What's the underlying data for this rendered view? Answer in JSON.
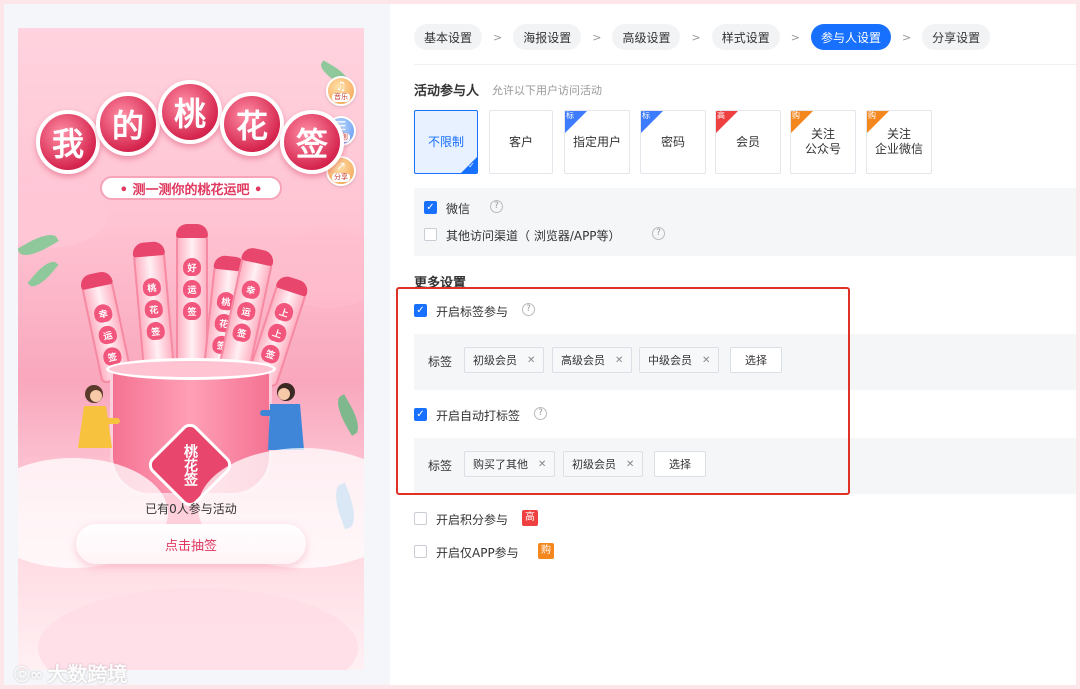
{
  "preview": {
    "title_chars": [
      "我",
      "的",
      "桃",
      "花",
      "签"
    ],
    "subtitle": "• 测一测你的桃花运吧 •",
    "side_buttons": [
      {
        "label": "音乐",
        "icon": "music-icon"
      },
      {
        "label": "规则",
        "icon": "rules-icon"
      },
      {
        "label": "分享",
        "icon": "share-icon"
      }
    ],
    "sticks": [
      {
        "chars": [
          "幸",
          "运",
          "签"
        ]
      },
      {
        "chars": [
          "桃",
          "花",
          "签"
        ]
      },
      {
        "chars": [
          "好",
          "运",
          "签"
        ]
      },
      {
        "chars": [
          "桃",
          "花",
          "签"
        ]
      },
      {
        "chars": [
          "幸",
          "运",
          "签"
        ]
      },
      {
        "chars": [
          "上",
          "上",
          "签"
        ]
      }
    ],
    "cup_label": "桃花签",
    "participants_text": "已有0人参与活动",
    "draw_button": "点击抽签",
    "watermark": "大数跨境",
    "colors": {
      "primary_pink": "#e8466c",
      "accent": "#e0385f"
    }
  },
  "steps": [
    {
      "label": "基本设置",
      "active": false
    },
    {
      "label": "海报设置",
      "active": false
    },
    {
      "label": "高级设置",
      "active": false
    },
    {
      "label": "样式设置",
      "active": false
    },
    {
      "label": "参与人设置",
      "active": true
    },
    {
      "label": "分享设置",
      "active": false
    }
  ],
  "step_separator": ">",
  "participants": {
    "title": "活动参与人",
    "hint": "允许以下用户访问活动",
    "options": [
      {
        "label": "不限制",
        "selected": true,
        "corner": null
      },
      {
        "label": "客户",
        "selected": false,
        "corner": null
      },
      {
        "label": "指定用户",
        "selected": false,
        "corner": "标",
        "corner_color": "blue"
      },
      {
        "label": "密码",
        "selected": false,
        "corner": "标",
        "corner_color": "blue"
      },
      {
        "label": "会员",
        "selected": false,
        "corner": "高",
        "corner_color": "red"
      },
      {
        "label": "关注\n公众号",
        "selected": false,
        "corner": "购",
        "corner_color": "orange"
      },
      {
        "label": "关注\n企业微信",
        "selected": false,
        "corner": "购",
        "corner_color": "orange"
      }
    ],
    "channels": [
      {
        "label": "微信",
        "checked": true
      },
      {
        "label": "其他访问渠道（ 浏览器/APP等）",
        "checked": false
      }
    ]
  },
  "more": {
    "title": "更多设置",
    "tag_join": {
      "label": "开启标签参与",
      "checked": true,
      "tags_label": "标签",
      "tags": [
        "初级会员",
        "高级会员",
        "中级会员"
      ],
      "select_button": "选择"
    },
    "auto_tag": {
      "label": "开启自动打标签",
      "checked": true,
      "tags_label": "标签",
      "tags": [
        "购买了其他",
        "初级会员"
      ],
      "select_button": "选择"
    },
    "points_join": {
      "label": "开启积分参与",
      "checked": false,
      "badge": "高",
      "badge_color": "#ee4040"
    },
    "app_only": {
      "label": "开启仅APP参与",
      "checked": false,
      "badge": "购",
      "badge_color": "#f5871f"
    }
  },
  "colors": {
    "primary": "#1870ff",
    "highlight_frame": "#e03127"
  }
}
